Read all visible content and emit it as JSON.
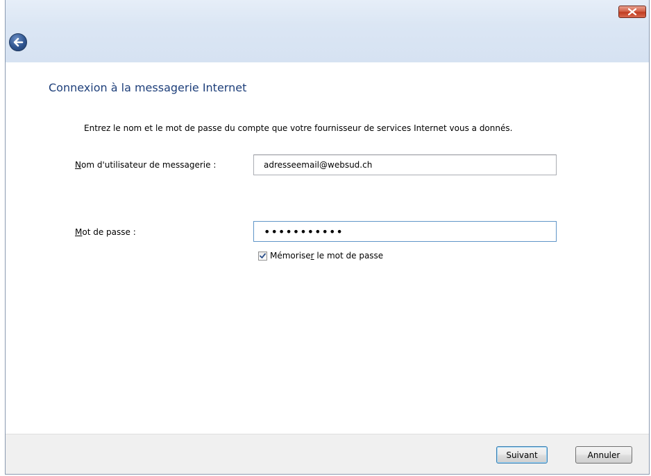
{
  "window": {
    "close_icon": "close-x-icon",
    "back_icon": "back-arrow-icon"
  },
  "page": {
    "title": "Connexion à la messagerie Internet",
    "instructions": "Entrez le nom et le mot de passe du compte que votre fournisseur de services Internet vous a donnés."
  },
  "username": {
    "label_mnemonic": "N",
    "label_rest": "om d'utilisateur de messagerie :",
    "value": "adresseemail@websud.ch"
  },
  "password": {
    "label_mnemonic": "M",
    "label_rest": "ot de passe :",
    "value": "•••••••••••"
  },
  "remember": {
    "label_before": "Mémorise",
    "label_mnemonic": "r",
    "label_after": " le mot de passe",
    "checked": true
  },
  "footer": {
    "next_label": "Suivant",
    "cancel_label": "Annuler"
  },
  "colors": {
    "title_blue": "#1e3f7a",
    "close_red": "#c03d22",
    "focus_border": "#5f95c8"
  }
}
